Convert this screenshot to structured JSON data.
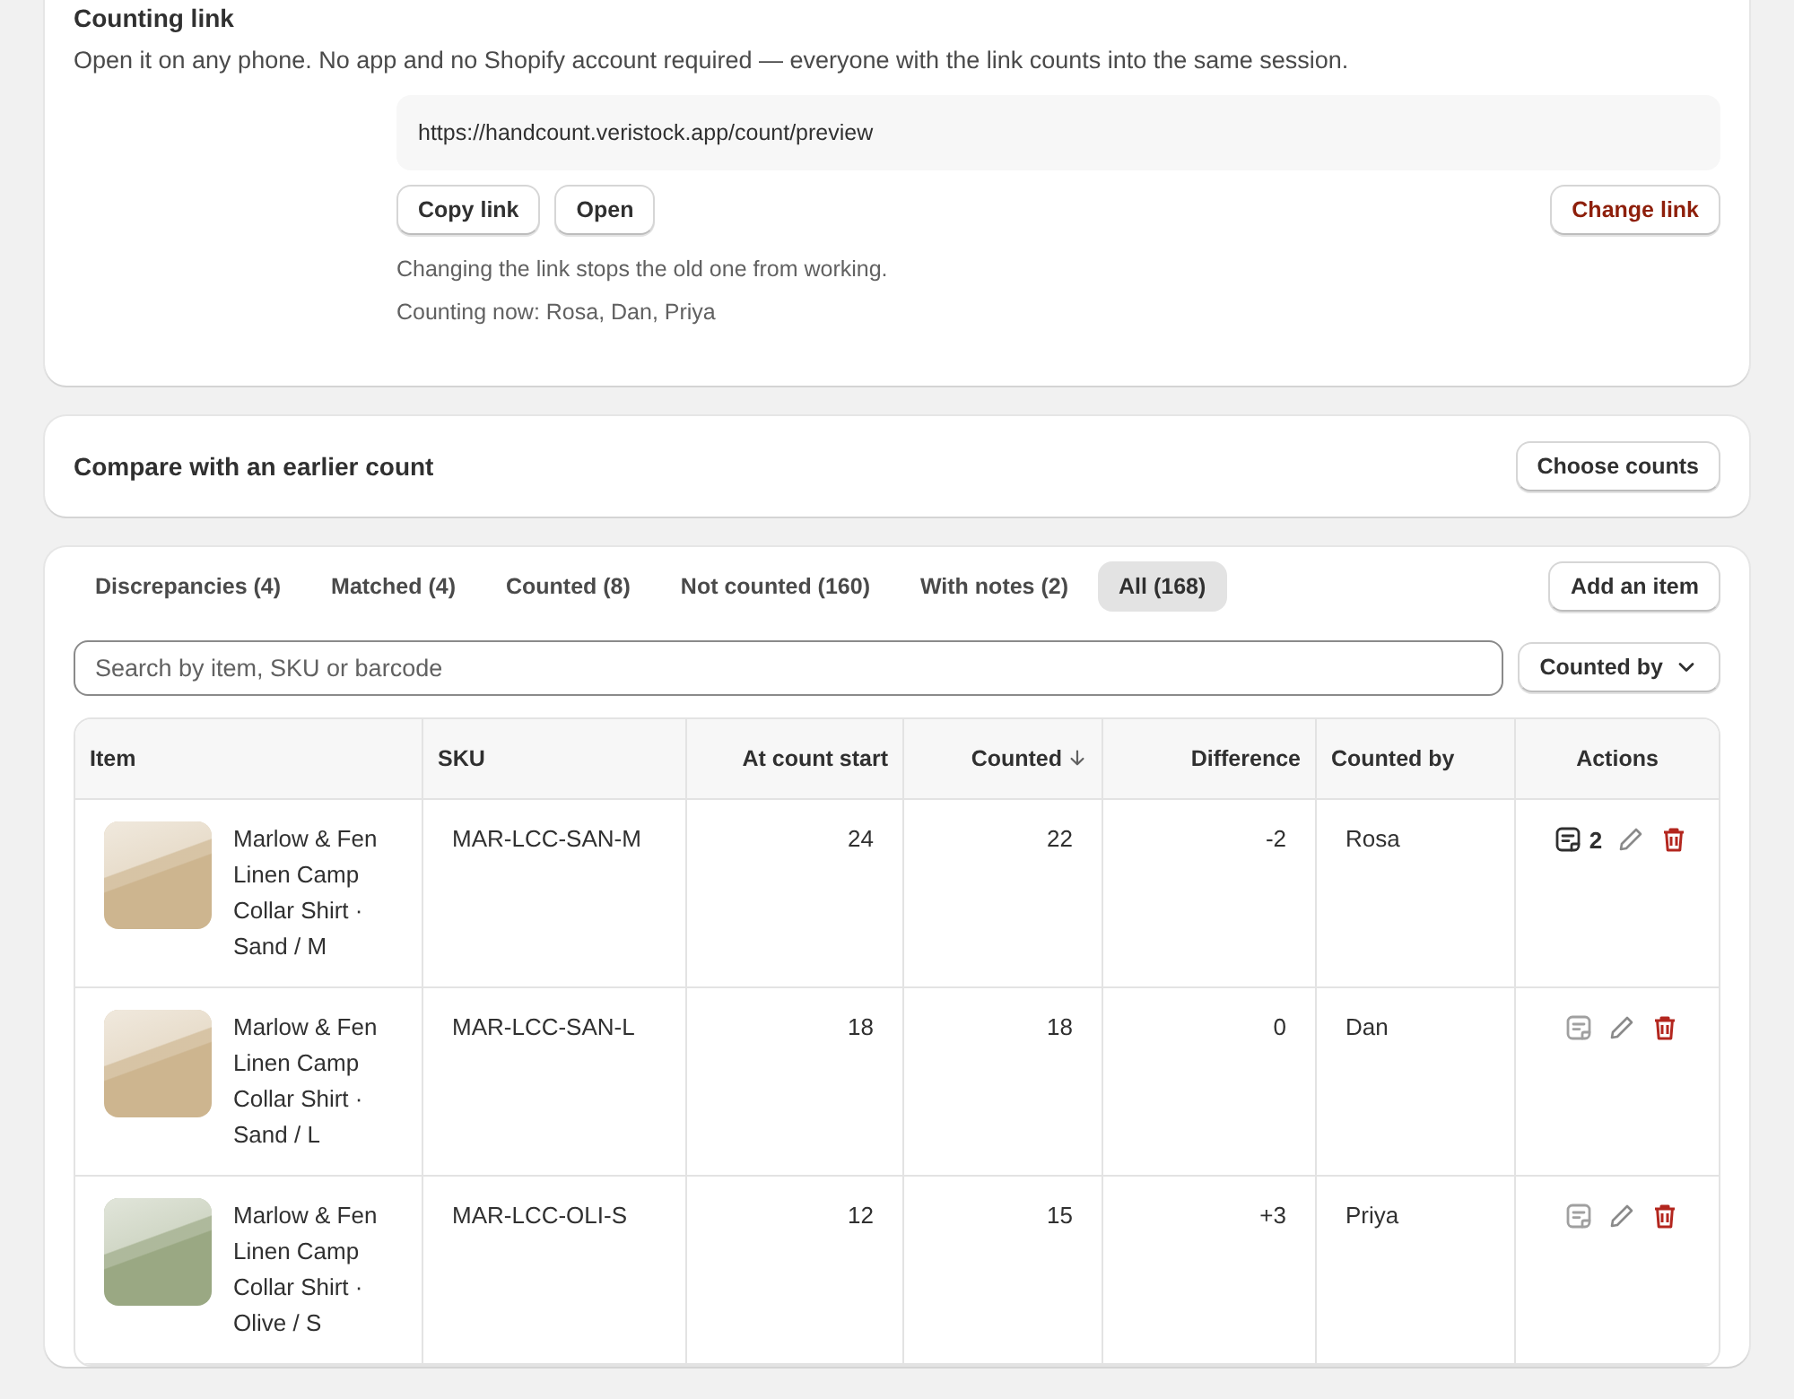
{
  "link_card": {
    "title": "Counting link",
    "description": "Open it on any phone. No app and no Shopify account required — everyone with the link counts into the same session.",
    "url": "https://handcount.veristock.app/count/preview",
    "buttons": [
      "Copy link",
      "Open"
    ],
    "change_button": {
      "label": "Change link",
      "kind": "critical"
    },
    "warning": "Changing the link stops the old one from working.",
    "counting_now": "Counting now: Rosa, Dan, Priya"
  },
  "compare_card": {
    "title": "Compare with an earlier count",
    "button": "Choose counts"
  },
  "items_card": {
    "tabs": [
      {
        "label": "Discrepancies (4)",
        "selected": false
      },
      {
        "label": "Matched (4)",
        "selected": false
      },
      {
        "label": "Counted (8)",
        "selected": false
      },
      {
        "label": "Not counted (160)",
        "selected": false
      },
      {
        "label": "With notes (2)",
        "selected": false
      },
      {
        "label": "All (168)",
        "selected": true
      }
    ],
    "add_button": "Add an item",
    "search": {
      "placeholder": "Search by item, SKU or barcode"
    },
    "filter": "Counted by",
    "table": {
      "columns": [
        {
          "label": "Item",
          "sorted": false
        },
        {
          "label": "SKU",
          "sorted": false
        },
        {
          "label": "At count start",
          "sorted": false
        },
        {
          "label": "Counted",
          "sorted": true
        },
        {
          "label": "Difference",
          "sorted": false
        },
        {
          "label": "Counted by",
          "sorted": false
        },
        {
          "label": "Actions",
          "sorted": false
        }
      ],
      "rows": [
        {
          "item": "Marlow & Fen Linen Camp Collar Shirt · Sand / M",
          "color": "#cdb58f",
          "sku": "MAR-LCC-SAN-M",
          "at_start": "24",
          "counted": "22",
          "difference": "-2",
          "counted_by": "Rosa",
          "has_notes": true,
          "notes_count": "2"
        },
        {
          "item": "Marlow & Fen Linen Camp Collar Shirt · Sand / L",
          "color": "#cdb58f",
          "sku": "MAR-LCC-SAN-L",
          "at_start": "18",
          "counted": "18",
          "difference": "0",
          "counted_by": "Dan",
          "has_notes": false
        },
        {
          "item": "Marlow & Fen Linen Camp Collar Shirt · Olive / S",
          "color": "#9aa883",
          "sku": "MAR-LCC-OLI-S",
          "at_start": "12",
          "counted": "15",
          "difference": "+3",
          "counted_by": "Priya",
          "has_notes": false
        }
      ]
    }
  }
}
